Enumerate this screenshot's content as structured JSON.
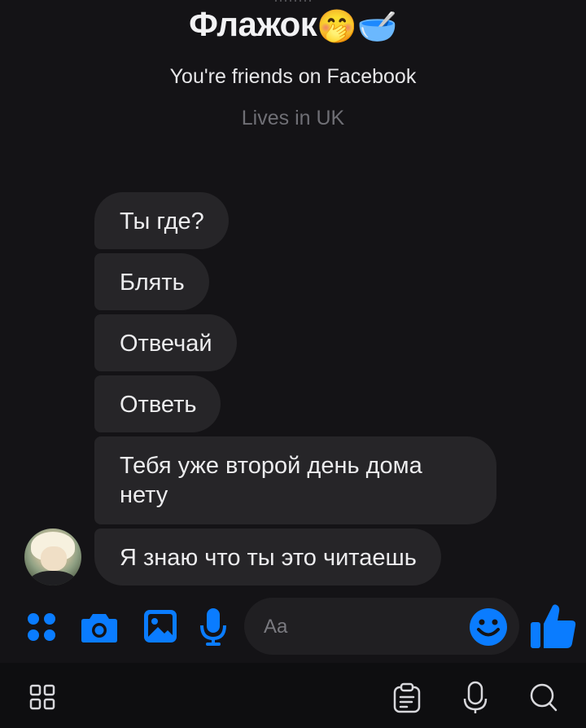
{
  "header": {
    "name": "Флажок",
    "name_emoji": "🤭🥣",
    "friends_text": "You're friends on Facebook",
    "location_text": "Lives in UK"
  },
  "messages": [
    {
      "text": "Ты где?"
    },
    {
      "text": "Блять"
    },
    {
      "text": "Отвечай"
    },
    {
      "text": "Ответь"
    },
    {
      "text": "Тебя уже второй день дома нету"
    },
    {
      "text": "Я знаю что ты это читаешь"
    }
  ],
  "composer": {
    "placeholder": "Aa",
    "icons": [
      "apps-icon",
      "camera-icon",
      "gallery-icon",
      "microphone-icon",
      "emoji-icon",
      "thumbs-up-icon"
    ]
  },
  "colors": {
    "accent": "#0a7cff",
    "background": "#141316",
    "bubble": "#262528"
  },
  "navbar": {
    "icons": [
      "grid-icon",
      "clipboard-icon",
      "assistant-mic-icon",
      "search-icon"
    ]
  }
}
